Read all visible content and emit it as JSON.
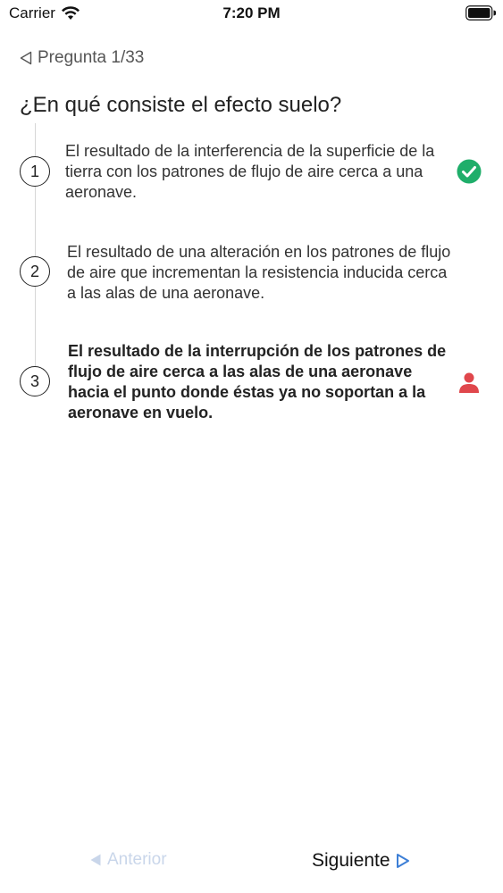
{
  "status_bar": {
    "carrier": "Carrier",
    "time": "7:20 PM"
  },
  "header": {
    "counter": "Pregunta 1/33"
  },
  "question": "¿En qué consiste el efecto suelo?",
  "options": [
    {
      "number": "1",
      "text": "El resultado de la interferencia de la superficie de la tierra con los patrones de flujo de aire cerca a una aeronave.",
      "status_icon": "check-circle-icon"
    },
    {
      "number": "2",
      "text": "El resultado de una alteración en los patrones de flujo de aire que incrementan la resistencia inducida cerca a las alas de una aeronave.",
      "status_icon": ""
    },
    {
      "number": "3",
      "text": "El resultado de la interrupción de los patrones de flujo de aire cerca a las alas de una aeronave hacia el punto donde éstas ya no soportan a la aeronave en vuelo.",
      "status_icon": "user-icon"
    }
  ],
  "nav": {
    "prev_label": "Anterior",
    "next_label": "Siguiente"
  },
  "colors": {
    "correct": "#1fae6a",
    "user_answer": "#e0474c",
    "accent": "#3d7fd6",
    "disabled": "#c9d6ea"
  }
}
